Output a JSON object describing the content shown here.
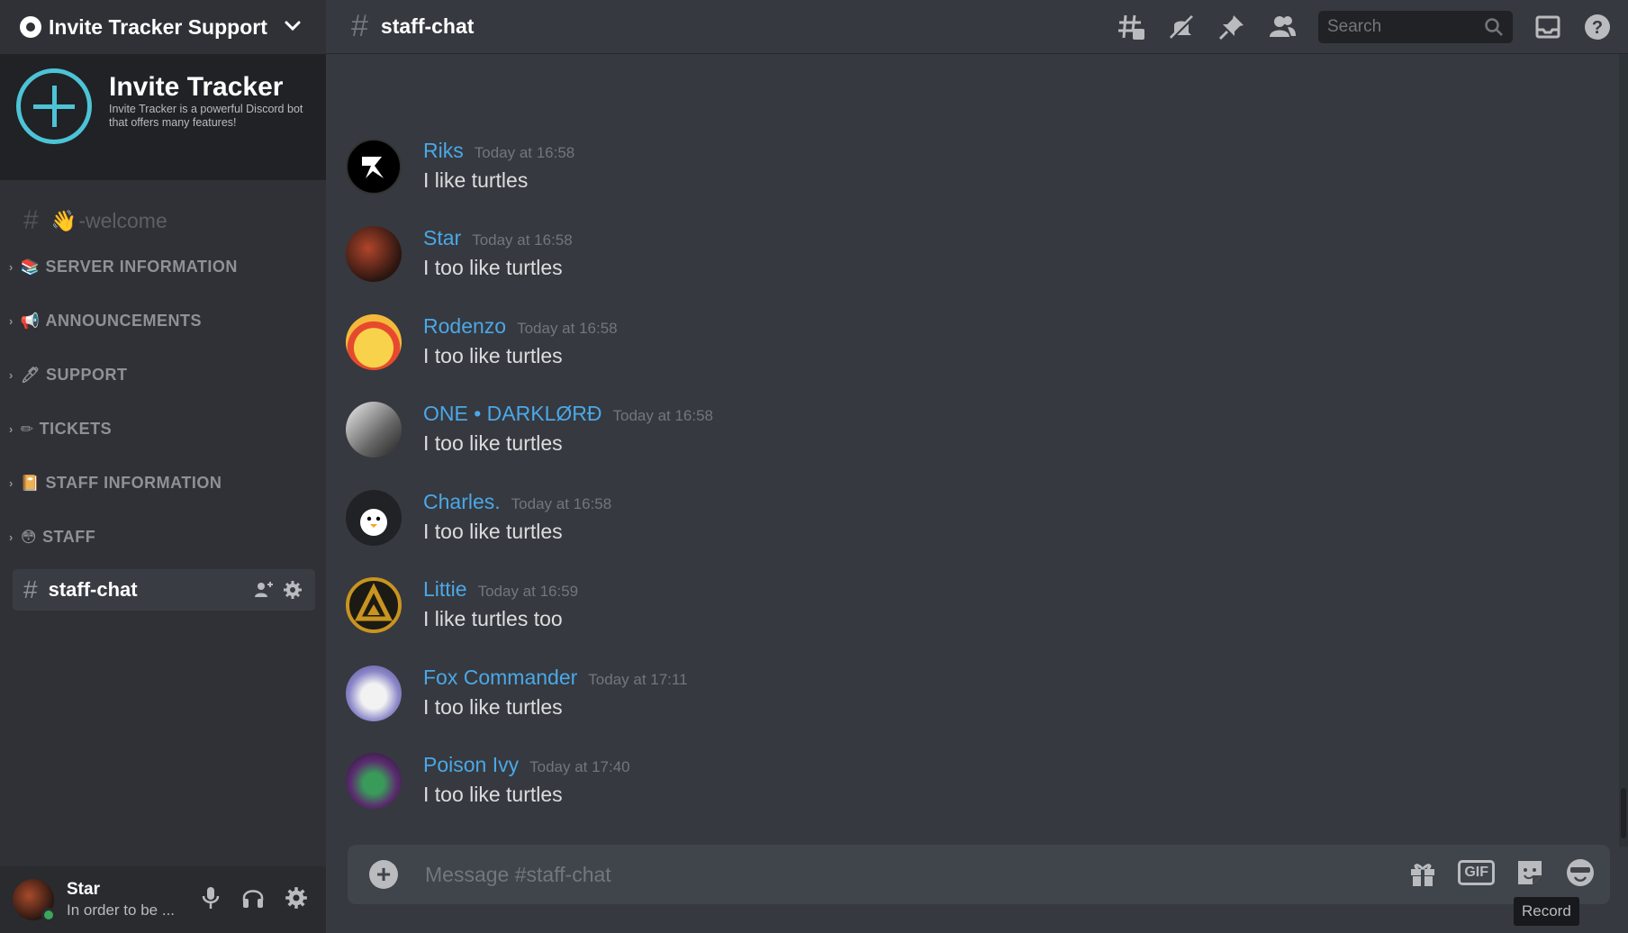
{
  "server": {
    "name": "Invite Tracker Support",
    "banner_title": "Invite Tracker",
    "banner_subtitle": "Invite Tracker is a powerful Discord bot that offers many features!"
  },
  "sidebar": {
    "welcome_channel": {
      "emoji": "👋",
      "label": "-welcome"
    },
    "categories": [
      {
        "emoji": "📚",
        "label": "SERVER INFORMATION"
      },
      {
        "emoji": "📢",
        "label": "ANNOUNCEMENTS"
      },
      {
        "emoji": "🖊",
        "label": "SUPPORT"
      },
      {
        "emoji": "✏",
        "label": "TICKETS"
      },
      {
        "emoji": "📔",
        "label": "STAFF INFORMATION"
      },
      {
        "emoji": "😳",
        "label": "STAFF"
      }
    ],
    "active_channel": "staff-chat"
  },
  "user_panel": {
    "name": "Star",
    "status": "In order to be ..."
  },
  "topbar": {
    "channel": "staff-chat",
    "search_placeholder": "Search"
  },
  "messages": [
    {
      "author": "Riks",
      "time": "Today at 16:58",
      "text": "I like turtles",
      "color": "#000000"
    },
    {
      "author": "Star",
      "time": "Today at 16:58",
      "text": "I too like turtles",
      "color": "#5a2a1f"
    },
    {
      "author": "Rodenzo",
      "time": "Today at 16:58",
      "text": "I too like turtles",
      "color": "#f5c542"
    },
    {
      "author": "ONE • DARKLØRÐ",
      "time": "Today at 16:58",
      "text": "I too like turtles",
      "color": "#d9d9d9"
    },
    {
      "author": "Charles.",
      "time": "Today at 16:58",
      "text": "I too like turtles",
      "color": "#202225"
    },
    {
      "author": "Littie",
      "time": "Today at 16:59",
      "text": "I like turtles too",
      "color": "#b88a1e"
    },
    {
      "author": "Fox Commander",
      "time": "Today at 17:11",
      "text": "I too like turtles",
      "color": "#8a86c8"
    },
    {
      "author": "Poison Ivy",
      "time": "Today at 17:40",
      "text": "I too like turtles",
      "color": "#5b2d6e"
    }
  ],
  "composer": {
    "placeholder": "Message #staff-chat",
    "gif_label": "GIF",
    "tooltip": "Record"
  }
}
